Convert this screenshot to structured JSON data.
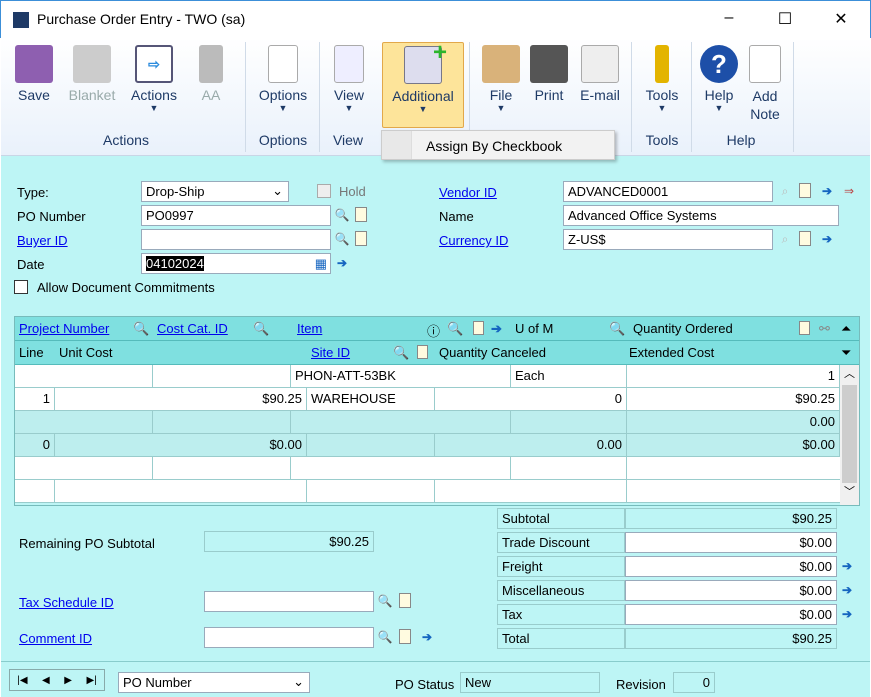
{
  "window": {
    "title": "Purchase Order Entry  -  TWO (sa)",
    "minimize": "–",
    "maximize": "☐",
    "close": "✕"
  },
  "ribbon": {
    "buttons": [
      {
        "label": "Save",
        "enabled": true
      },
      {
        "label": "Blanket",
        "enabled": false
      },
      {
        "label": "Actions",
        "enabled": true
      },
      {
        "label": "AA",
        "enabled": false
      },
      {
        "label": "Options"
      },
      {
        "label": "View"
      },
      {
        "label": "Additional"
      },
      {
        "label": "File"
      },
      {
        "label": "Print"
      },
      {
        "label": "E-mail"
      },
      {
        "label": "Tools"
      },
      {
        "label": "Help"
      },
      {
        "label": "Add Note"
      }
    ],
    "groups": [
      "Actions",
      "Options",
      "View",
      "Tools",
      "Help"
    ],
    "menu_item": "Assign By Checkbook",
    "dropdown_arrow": "▼"
  },
  "header": {
    "type_label": "Type:",
    "type_value": "Drop-Ship",
    "hold_label": "Hold",
    "po_number_label": "PO Number",
    "po_number": "PO0997",
    "buyer_label": "Buyer ID",
    "buyer": "",
    "date_label": "Date",
    "date": "04102024",
    "allow_label": "Allow Document Commitments",
    "vendor_label": "Vendor ID",
    "vendor": "ADVANCED0001",
    "name_label": "Name",
    "name": "Advanced Office Systems",
    "currency_label": "Currency ID",
    "currency": "Z-US$"
  },
  "grid": {
    "h1": [
      "Project Number",
      "Cost Cat. ID",
      "Item",
      "U of M",
      "Quantity Ordered"
    ],
    "h2": [
      "Line",
      "Unit Cost",
      "Site ID",
      "Quantity Canceled",
      "Extended Cost"
    ],
    "rows": [
      [
        "",
        "",
        "PHON-ATT-53BK",
        "Each",
        "1"
      ],
      [
        "1",
        "$90.25",
        "WAREHOUSE",
        "0",
        "$90.25"
      ],
      [
        "",
        "",
        "",
        "",
        "0.00"
      ],
      [
        "0",
        "$0.00",
        "",
        "0.00",
        "$0.00"
      ]
    ]
  },
  "totals": {
    "remaining_label": "Remaining PO Subtotal",
    "remaining": "$90.25",
    "tax_schedule_label": "Tax Schedule ID",
    "comment_label": "Comment ID",
    "items": [
      {
        "label": "Subtotal",
        "value": "$90.25"
      },
      {
        "label": "Trade Discount",
        "value": "$0.00"
      },
      {
        "label": "Freight",
        "value": "$0.00"
      },
      {
        "label": "Miscellaneous",
        "value": "$0.00"
      },
      {
        "label": "Tax",
        "value": "$0.00"
      },
      {
        "label": "Total",
        "value": "$90.25"
      }
    ]
  },
  "footer": {
    "browse_by": "PO Number",
    "status_label": "PO Status",
    "status": "New",
    "revision_label": "Revision",
    "revision": "0",
    "nav": [
      "|◀",
      "◀",
      "▶",
      "▶|"
    ]
  }
}
